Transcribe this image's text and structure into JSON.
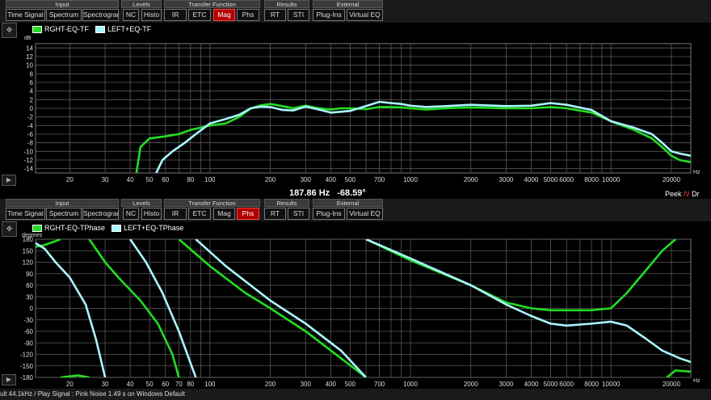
{
  "colors": {
    "green": "#22dd22",
    "cyan": "#aaf6ff",
    "active": "#b00000",
    "grid": "#5a5a5a"
  },
  "top_toolbar": {
    "groups": [
      {
        "title": "Input",
        "buttons": [
          "Time Signal",
          "Spectrum",
          "Spectrogram"
        ]
      },
      {
        "title": "Levels",
        "buttons": [
          "NC",
          "Histo"
        ]
      },
      {
        "title": "Transfer Function",
        "buttons": [
          "IR",
          "ETC",
          "Mag",
          "Phs"
        ]
      },
      {
        "title": "Results",
        "buttons": [
          "RT",
          "STI"
        ]
      },
      {
        "title": "External",
        "buttons": [
          "Plug-Ins",
          "Virtual EQ"
        ]
      }
    ],
    "active": "Mag"
  },
  "bottom_toolbar": {
    "groups": [
      {
        "title": "Input",
        "buttons": [
          "Time Signal",
          "Spectrum",
          "Spectrogram"
        ]
      },
      {
        "title": "Levels",
        "buttons": [
          "NC",
          "Histo"
        ]
      },
      {
        "title": "Transfer Function",
        "buttons": [
          "IR",
          "ETC",
          "Mag",
          "Phs"
        ]
      },
      {
        "title": "Results",
        "buttons": [
          "RT",
          "STI"
        ]
      },
      {
        "title": "External",
        "buttons": [
          "Plug-Ins",
          "Virtual EQ"
        ]
      }
    ],
    "active": "Phs"
  },
  "nav_icon": "move-arrows-icon",
  "play_icon": "play-icon",
  "mag_panel": {
    "legend": [
      "RGHT-EQ-TF",
      "LEFT+EQ-TF"
    ],
    "yunit": "dB",
    "xunit": "Hz",
    "yticks": [
      "14",
      "12",
      "10",
      "8",
      "6",
      "4",
      "2",
      "0",
      "-2",
      "-4",
      "-6",
      "-8",
      "-10",
      "-12",
      "-14"
    ],
    "xticks": [
      "20",
      "30",
      "40",
      "50",
      "60",
      "80",
      "100",
      "200",
      "300",
      "400",
      "500",
      "700",
      "1000",
      "2000",
      "3000",
      "4000",
      "5000",
      "6000",
      "8000",
      "10000",
      "20000"
    ]
  },
  "readout": {
    "freq": "187.86 Hz",
    "value": "-68.59°"
  },
  "peek": {
    "label": "Peek",
    "tail": "Dr"
  },
  "phase_panel": {
    "legend": [
      "RGHT-EQ-TPhase",
      "LEFT+EQ-TPhase"
    ],
    "yunit": "degrees",
    "xunit": "Hz",
    "yticks": [
      "180",
      "150",
      "120",
      "90",
      "60",
      "30",
      "0",
      "-30",
      "-60",
      "-90",
      "-120",
      "-150",
      "-180"
    ],
    "xticks": [
      "20",
      "30",
      "40",
      "50",
      "60",
      "70",
      "80",
      "100",
      "200",
      "300",
      "400",
      "500",
      "700",
      "1000",
      "2000",
      "3000",
      "4000",
      "5000",
      "6000",
      "8000",
      "10000",
      "20000"
    ]
  },
  "status": {
    "text": "ult 44.1kHz / Play Signal : Pink Noise  1.49 s on Windows Default"
  },
  "chart_data": [
    {
      "type": "line",
      "name": "Transfer Function Magnitude",
      "xscale": "log",
      "xlim": [
        13.5,
        25000
      ],
      "ylim": [
        -15,
        15
      ],
      "ylabel": "dB",
      "xlabel": "Hz",
      "grid": true,
      "legend_placement": "top-left",
      "series": [
        {
          "name": "RGHT-EQ-TF",
          "color": "#22dd22",
          "points": [
            [
              43,
              -15
            ],
            [
              45,
              -9
            ],
            [
              50,
              -7
            ],
            [
              60,
              -6.5
            ],
            [
              70,
              -6
            ],
            [
              80,
              -5
            ],
            [
              90,
              -4.5
            ],
            [
              100,
              -4
            ],
            [
              120,
              -3.5
            ],
            [
              140,
              -2
            ],
            [
              160,
              0
            ],
            [
              180,
              0.7
            ],
            [
              200,
              1
            ],
            [
              230,
              0.5
            ],
            [
              260,
              0
            ],
            [
              300,
              0.6
            ],
            [
              350,
              0
            ],
            [
              400,
              -0.3
            ],
            [
              450,
              0
            ],
            [
              500,
              0
            ],
            [
              600,
              -0.2
            ],
            [
              700,
              0.3
            ],
            [
              800,
              0.3
            ],
            [
              900,
              0.2
            ],
            [
              1000,
              0
            ],
            [
              1200,
              -0.3
            ],
            [
              1500,
              0
            ],
            [
              2000,
              0.2
            ],
            [
              3000,
              0
            ],
            [
              4000,
              0
            ],
            [
              5000,
              0.3
            ],
            [
              6000,
              0
            ],
            [
              8000,
              -1
            ],
            [
              10000,
              -3
            ],
            [
              13000,
              -5
            ],
            [
              16000,
              -7
            ],
            [
              18000,
              -9
            ],
            [
              20000,
              -11
            ],
            [
              22000,
              -12
            ],
            [
              25000,
              -12.5
            ]
          ]
        },
        {
          "name": "LEFT+EQ-TF",
          "color": "#aaf6ff",
          "points": [
            [
              54,
              -15
            ],
            [
              58,
              -12
            ],
            [
              65,
              -10
            ],
            [
              75,
              -8
            ],
            [
              85,
              -6
            ],
            [
              100,
              -3.5
            ],
            [
              120,
              -2.5
            ],
            [
              140,
              -1.5
            ],
            [
              160,
              0
            ],
            [
              180,
              0.4
            ],
            [
              200,
              0.3
            ],
            [
              230,
              -0.4
            ],
            [
              260,
              -0.5
            ],
            [
              300,
              0.4
            ],
            [
              350,
              -0.3
            ],
            [
              400,
              -1
            ],
            [
              450,
              -0.8
            ],
            [
              500,
              -0.6
            ],
            [
              600,
              0.5
            ],
            [
              700,
              1.5
            ],
            [
              800,
              1.2
            ],
            [
              900,
              1
            ],
            [
              1000,
              0.6
            ],
            [
              1200,
              0.3
            ],
            [
              1500,
              0.5
            ],
            [
              2000,
              0.8
            ],
            [
              3000,
              0.5
            ],
            [
              4000,
              0.6
            ],
            [
              5000,
              1.2
            ],
            [
              6000,
              0.8
            ],
            [
              8000,
              -0.4
            ],
            [
              10000,
              -3
            ],
            [
              13000,
              -4.5
            ],
            [
              16000,
              -6
            ],
            [
              18000,
              -8
            ],
            [
              20000,
              -10
            ],
            [
              22000,
              -10.5
            ],
            [
              25000,
              -11
            ]
          ]
        }
      ]
    },
    {
      "type": "line",
      "name": "Transfer Function Phase",
      "xscale": "log",
      "xlim": [
        13.5,
        25000
      ],
      "ylim": [
        -180,
        180
      ],
      "ylabel": "degrees",
      "xlabel": "Hz",
      "grid": true,
      "legend_placement": "top-left",
      "series": [
        {
          "name": "RGHT-EQ-TPhase",
          "color": "#22dd22",
          "segments": [
            [
              [
                13.5,
                160
              ],
              [
                15,
                165
              ],
              [
                17,
                175
              ],
              [
                18,
                180
              ]
            ],
            [
              [
                25,
                180
              ],
              [
                30,
                120
              ],
              [
                35,
                80
              ],
              [
                45,
                20
              ],
              [
                55,
                -40
              ],
              [
                65,
                -120
              ],
              [
                70,
                -180
              ]
            ],
            [
              [
                70,
                180
              ],
              [
                100,
                110
              ],
              [
                150,
                40
              ],
              [
                200,
                0
              ],
              [
                300,
                -60
              ],
              [
                450,
                -130
              ],
              [
                600,
                -180
              ]
            ],
            [
              [
                600,
                180
              ],
              [
                1000,
                125
              ],
              [
                2000,
                60
              ],
              [
                3000,
                15
              ],
              [
                4000,
                0
              ],
              [
                5000,
                -5
              ],
              [
                8000,
                -5
              ],
              [
                10000,
                0
              ],
              [
                12000,
                40
              ],
              [
                15000,
                100
              ],
              [
                18000,
                150
              ],
              [
                21000,
                180
              ]
            ],
            [
              [
                19000,
                -180
              ],
              [
                21000,
                -162
              ],
              [
                25000,
                -165
              ]
            ],
            [
              [
                18,
                -180
              ],
              [
                22,
                -175
              ],
              [
                25,
                -180
              ]
            ]
          ]
        },
        {
          "name": "LEFT+EQ-TPhase",
          "color": "#aaf6ff",
          "segments": [
            [
              [
                13.5,
                170
              ],
              [
                15,
                155
              ],
              [
                17,
                120
              ],
              [
                20,
                80
              ],
              [
                24,
                10
              ],
              [
                27,
                -80
              ],
              [
                30,
                -180
              ]
            ],
            [
              [
                40,
                180
              ],
              [
                48,
                120
              ],
              [
                58,
                40
              ],
              [
                70,
                -60
              ],
              [
                85,
                -180
              ]
            ],
            [
              [
                85,
                180
              ],
              [
                120,
                110
              ],
              [
                200,
                20
              ],
              [
                300,
                -40
              ],
              [
                450,
                -110
              ],
              [
                600,
                -180
              ]
            ],
            [
              [
                600,
                180
              ],
              [
                1000,
                130
              ],
              [
                2000,
                60
              ],
              [
                3000,
                10
              ],
              [
                4000,
                -20
              ],
              [
                5000,
                -40
              ],
              [
                6000,
                -45
              ],
              [
                8000,
                -40
              ],
              [
                10000,
                -35
              ],
              [
                12000,
                -45
              ],
              [
                15000,
                -80
              ],
              [
                18000,
                -110
              ],
              [
                22000,
                -130
              ],
              [
                25000,
                -140
              ]
            ]
          ]
        }
      ]
    }
  ]
}
